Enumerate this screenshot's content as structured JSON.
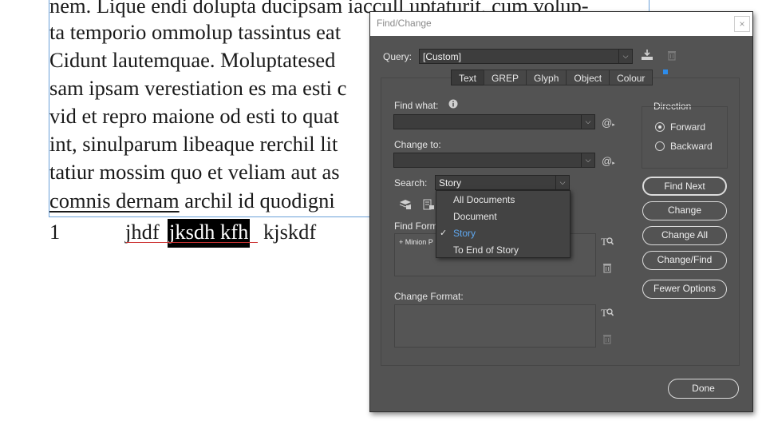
{
  "document": {
    "lines": [
      "nem. Lique endi dolupta ducipsam iaccull uptaturit, cum volup-",
      "ta temporio ommolup tassintus eat",
      "Cidunt lautemquae. Moluptatesed",
      "sam ipsam verestiation es ma esti c",
      "vid et repro maione od esti to quat",
      "int, sinulparum libeaque rerchil lit",
      "tatiur mossim quo et veliam aut as"
    ],
    "last_line_underlined": "comnis dernam",
    "last_line_rest": " archil id quodigni",
    "footer": {
      "number": "1",
      "word1": "jhdf",
      "selected": "jksdh kfh",
      "word3": "kjskdf"
    }
  },
  "dialog": {
    "title": "Find/Change",
    "close_label": "×",
    "query_label": "Query:",
    "query_value": "[Custom]",
    "tabs": [
      {
        "label": "Text",
        "active": true
      },
      {
        "label": "GREP",
        "active": false
      },
      {
        "label": "Glyph",
        "active": false
      },
      {
        "label": "Object",
        "active": false
      },
      {
        "label": "Colour",
        "active": false
      }
    ],
    "find_what_label": "Find what:",
    "find_what_value": "",
    "change_to_label": "Change to:",
    "change_to_value": "",
    "search_label": "Search:",
    "search_value": "Story",
    "search_options": [
      "All Documents",
      "Document",
      "Story",
      "To End of Story"
    ],
    "search_selected": "Story",
    "find_format_label": "Find Form",
    "find_format_item": "+ Minion P",
    "change_format_label": "Change Format:",
    "direction_label": "Direction",
    "direction_forward": "Forward",
    "direction_backward": "Backward",
    "direction_selected": "Forward",
    "buttons": {
      "find_next": "Find Next",
      "change": "Change",
      "change_all": "Change All",
      "change_find": "Change/Find",
      "fewer_options": "Fewer Options",
      "done": "Done"
    },
    "icons": {
      "info": "info-icon",
      "save_query": "save-query-icon",
      "delete_query": "trash-icon",
      "special_chars": "at-special-char-icon",
      "spec_format": "find-format-icon"
    },
    "accent_color": "#2d8ceb"
  }
}
